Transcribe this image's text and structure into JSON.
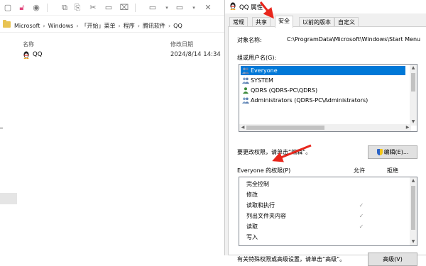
{
  "explorer": {
    "breadcrumbs": [
      "Microsoft",
      "Windows",
      "「开始」菜单",
      "程序",
      "腾讯软件",
      "QQ"
    ],
    "columns": {
      "name": "名称",
      "modified": "修改日期"
    },
    "files": [
      {
        "name": "QQ",
        "modified": "2024/8/14 14:34",
        "icon": "qq-penguin-icon"
      }
    ]
  },
  "dialog": {
    "title": "QQ 属性",
    "tabs": [
      "常规",
      "共享",
      "安全",
      "以前的版本",
      "自定义"
    ],
    "active_tab": "安全",
    "object_name_label": "对象名称:",
    "object_name_value": "C:\\ProgramData\\Microsoft\\Windows\\Start Menu",
    "group_label": "组或用户名(G):",
    "users": [
      {
        "name": "Everyone",
        "selected": true
      },
      {
        "name": "SYSTEM",
        "selected": false
      },
      {
        "name": "QDRS (QDRS-PC\\QDRS)",
        "selected": false
      },
      {
        "name": "Administrators (QDRS-PC\\Administrators)",
        "selected": false
      }
    ],
    "change_hint": "要更改权限，请单击“编辑”。",
    "edit_button": "编辑(E)...",
    "perm_header": {
      "title": "Everyone 的权限(P)",
      "allow": "允许",
      "deny": "拒绝"
    },
    "permissions": [
      {
        "name": "完全控制",
        "allow": false,
        "deny": false
      },
      {
        "name": "修改",
        "allow": false,
        "deny": false
      },
      {
        "name": "读取和执行",
        "allow": true,
        "deny": false
      },
      {
        "name": "列出文件夹内容",
        "allow": true,
        "deny": false
      },
      {
        "name": "读取",
        "allow": true,
        "deny": false
      },
      {
        "name": "写入",
        "allow": false,
        "deny": false
      }
    ],
    "advanced_hint": "有关特殊权限或高级设置，请单击“高级”。",
    "advanced_button": "高级(V)"
  },
  "colors": {
    "selection": "#0078d7",
    "annotation_arrow": "#e8261c"
  }
}
